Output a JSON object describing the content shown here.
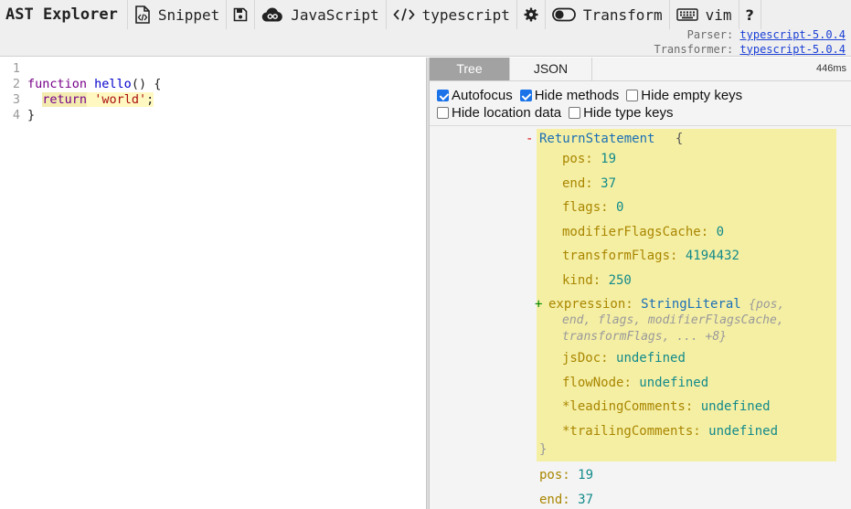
{
  "toolbar": {
    "title": "AST Explorer",
    "snippet_label": "Snippet",
    "language_label": "JavaScript",
    "parser_label": "typescript",
    "transform_label": "Transform",
    "keymap_label": "vim",
    "help_label": "?",
    "parser_prefix": "Parser:",
    "parser_link": "typescript-5.0.4",
    "transformer_prefix": "Transformer:",
    "transformer_link": "typescript-5.0.4",
    "icons": [
      "snippet-icon",
      "save-icon",
      "cloud-icon",
      "code-icon",
      "gear-icon",
      "toggle-icon",
      "keyboard-icon"
    ]
  },
  "editor": {
    "lines": [
      {
        "num": "1",
        "tokens": []
      },
      {
        "num": "2",
        "tokens": [
          {
            "text": "function",
            "cls": "kw-fn"
          },
          {
            "text": " "
          },
          {
            "text": "hello",
            "cls": "fn-name"
          },
          {
            "text": "() {"
          }
        ]
      },
      {
        "num": "3",
        "tokens": [
          {
            "text": "  "
          },
          {
            "text": "return",
            "cls": "kw-ret hl-kw"
          },
          {
            "text": " ",
            "cls": "hl"
          },
          {
            "text": "'world'",
            "cls": "str hl"
          },
          {
            "text": ";",
            "cls": "hl"
          }
        ]
      },
      {
        "num": "4",
        "tokens": [
          {
            "text": "}"
          }
        ]
      }
    ]
  },
  "output": {
    "tabs": [
      "Tree",
      "JSON"
    ],
    "active_tab": "Tree",
    "timing": "446ms",
    "options": {
      "autofocus": {
        "label": "Autofocus",
        "checked": true
      },
      "hide_methods": {
        "label": "Hide methods",
        "checked": true
      },
      "hide_empty_keys": {
        "label": "Hide empty keys",
        "checked": false
      },
      "hide_location_data": {
        "label": "Hide location data",
        "checked": false
      },
      "hide_type_keys": {
        "label": "Hide type keys",
        "checked": false
      }
    },
    "tree": {
      "node_toggle": "-",
      "node_type": "ReturnStatement",
      "node_open_brace": "{",
      "props": [
        {
          "key": "pos",
          "value": "19"
        },
        {
          "key": "end",
          "value": "37"
        },
        {
          "key": "flags",
          "value": "0"
        },
        {
          "key": "modifierFlagsCache",
          "value": "0"
        },
        {
          "key": "transformFlags",
          "value": "4194432"
        },
        {
          "key": "kind",
          "value": "250"
        }
      ],
      "expression": {
        "toggle": "+",
        "key": "expression",
        "type": "StringLiteral",
        "summary_1": "{pos,",
        "summary_2": "end, flags, modifierFlagsCache,",
        "summary_3": "transformFlags, ... +8}"
      },
      "props_after": [
        {
          "key": "jsDoc",
          "value": "undefined"
        },
        {
          "key": "flowNode",
          "value": "undefined"
        },
        {
          "key": "*leadingComments",
          "value": "undefined"
        },
        {
          "key": "*trailingComments",
          "value": "undefined"
        }
      ],
      "node_close_brace": "}",
      "parent_props": [
        {
          "key": "pos",
          "value": "19"
        },
        {
          "key": "end",
          "value": "37"
        }
      ]
    }
  }
}
